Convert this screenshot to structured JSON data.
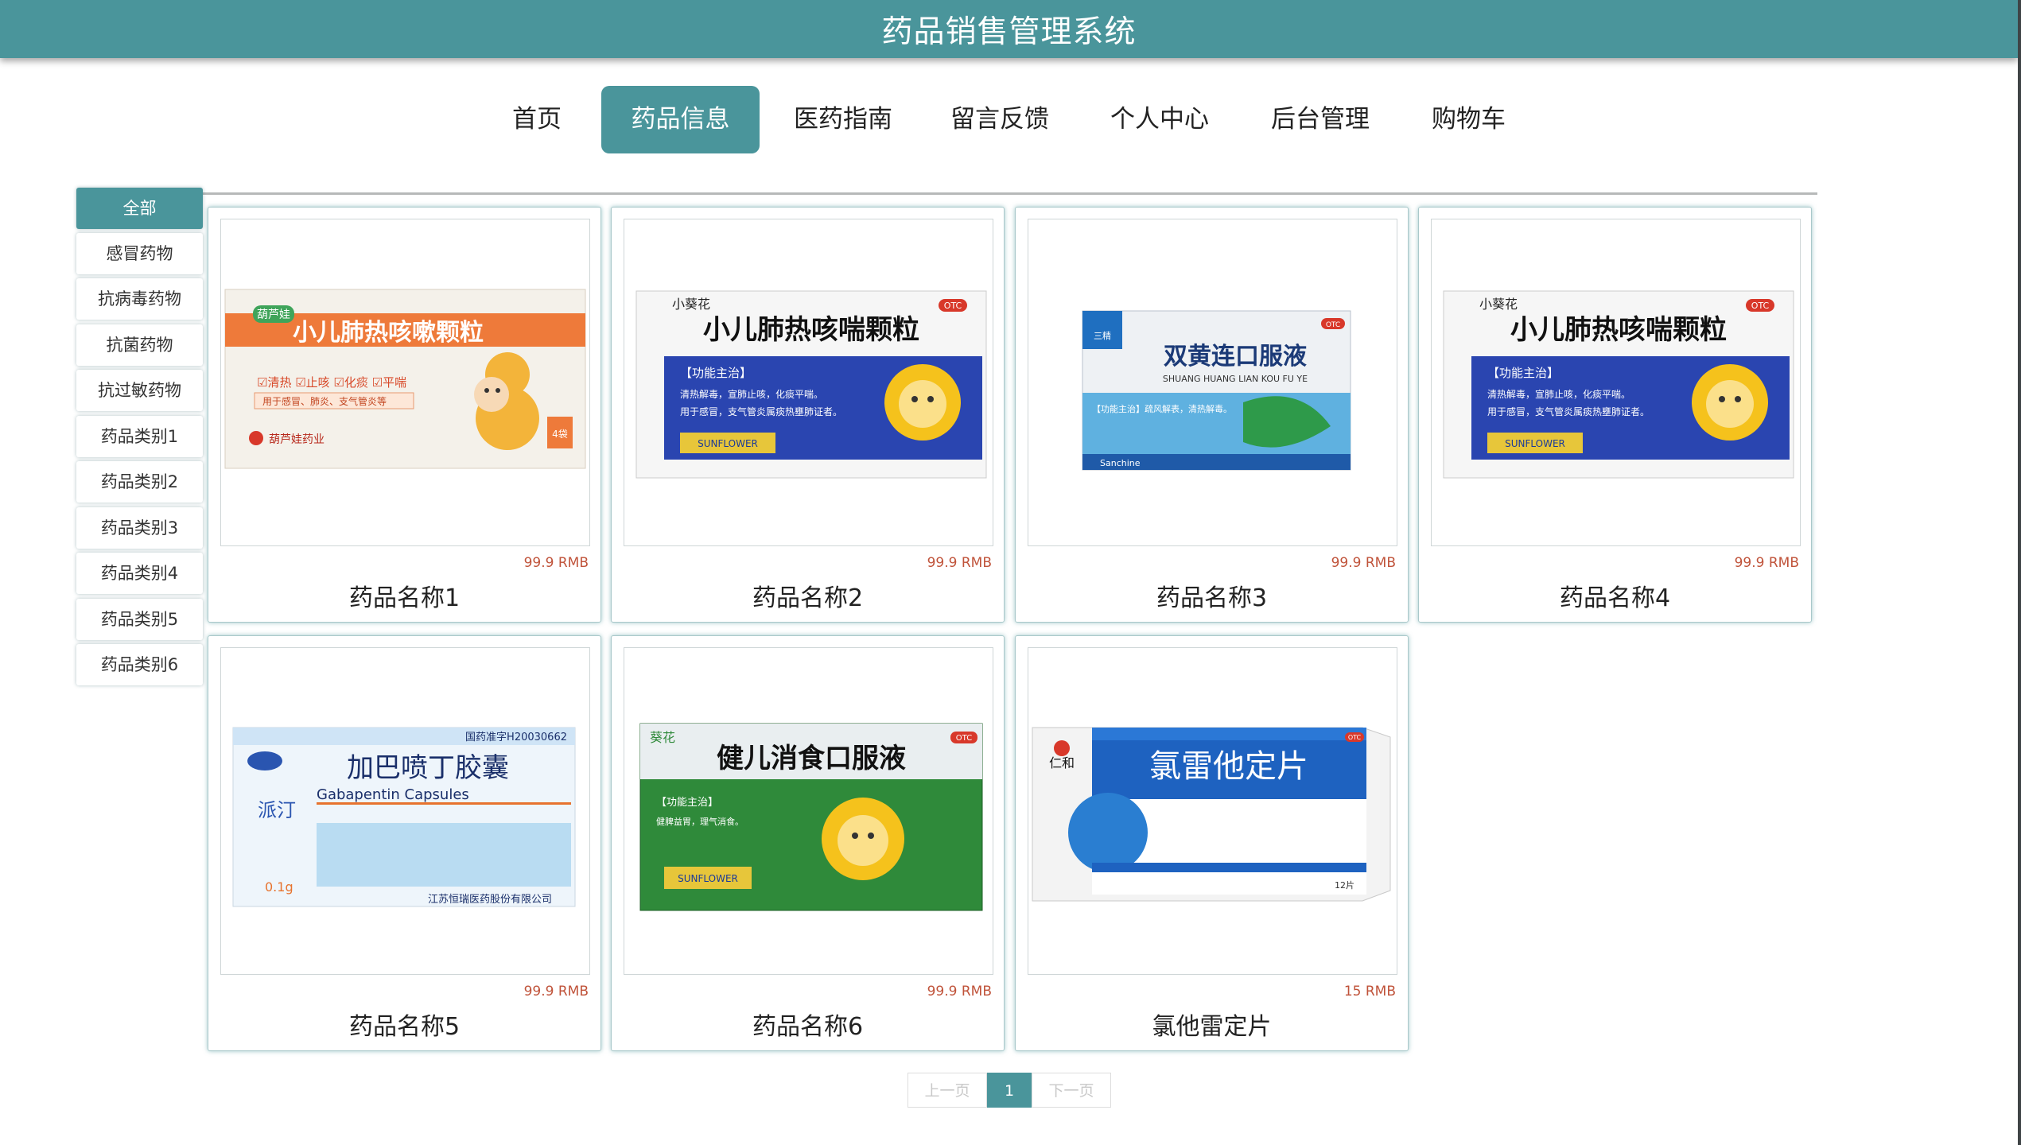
{
  "header": {
    "title": "药品销售管理系统"
  },
  "nav": {
    "items": [
      {
        "label": "首页"
      },
      {
        "label": "药品信息",
        "active": true
      },
      {
        "label": "医药指南"
      },
      {
        "label": "留言反馈"
      },
      {
        "label": "个人中心"
      },
      {
        "label": "后台管理"
      },
      {
        "label": "购物车"
      }
    ]
  },
  "sidebar": {
    "items": [
      {
        "label": "全部",
        "active": true
      },
      {
        "label": "感冒药物"
      },
      {
        "label": "抗病毒药物"
      },
      {
        "label": "抗菌药物"
      },
      {
        "label": "抗过敏药物"
      },
      {
        "label": "药品类别1"
      },
      {
        "label": "药品类别2"
      },
      {
        "label": "药品类别3"
      },
      {
        "label": "药品类别4"
      },
      {
        "label": "药品类别5"
      },
      {
        "label": "药品类别6"
      }
    ]
  },
  "products": [
    {
      "name": "药品名称1",
      "price": "99.9 RMB",
      "box": {
        "brand": "葫芦娃",
        "title": "小儿肺热咳嗽颗粒",
        "tags": "☑清热 ☑止咳 ☑化痰 ☑平喘",
        "usage": "用于感冒、肺炎、支气管炎等",
        "maker": "葫芦娃药业",
        "count": "4袋"
      }
    },
    {
      "name": "药品名称2",
      "price": "99.9 RMB",
      "box": {
        "brand": "小葵花",
        "otc": "OTC",
        "title": "小儿肺热咳喘颗粒",
        "section": "【功能主治】",
        "desc1": "清热解毒，宣肺止咳，化痰平喘。",
        "desc2": "用于感冒，支气管炎属痰热壅肺证者。",
        "logo": "SUNFLOWER"
      }
    },
    {
      "name": "药品名称3",
      "price": "99.9 RMB",
      "box": {
        "brand": "三精",
        "otc": "OTC",
        "title": "双黄连口服液",
        "pinyin": "SHUANG HUANG LIAN KOU FU YE",
        "desc1": "【功能主治】疏风解表，清热解毒。",
        "maker": "Sanchine"
      }
    },
    {
      "name": "药品名称4",
      "price": "99.9 RMB",
      "box": {
        "brand": "小葵花",
        "otc": "OTC",
        "title": "小儿肺热咳喘颗粒",
        "section": "【功能主治】",
        "desc1": "清热解毒，宣肺止咳，化痰平喘。",
        "desc2": "用于感冒，支气管炎属痰热壅肺证者。",
        "logo": "SUNFLOWER"
      }
    },
    {
      "name": "药品名称5",
      "price": "99.9 RMB",
      "box": {
        "approval": "国药准字H20030662",
        "brand": "派汀",
        "title": "加巴喷丁胶囊",
        "english": "Gabapentin Capsules",
        "dose": "0.1g",
        "maker": "江苏恒瑞医药股份有限公司"
      }
    },
    {
      "name": "药品名称6",
      "price": "99.9 RMB",
      "box": {
        "brand": "葵花",
        "otc": "OTC",
        "title": "健儿消食口服液",
        "section": "【功能主治】",
        "desc1": "健脾益胃，理气消食。",
        "logo": "SUNFLOWER"
      }
    },
    {
      "name": "氯他雷定片",
      "price": "15 RMB",
      "box": {
        "brand": "仁和",
        "otc": "OTC",
        "title": "氯雷他定片",
        "count": "12片"
      }
    }
  ],
  "pagination": {
    "prev": "上一页",
    "current": "1",
    "next": "下一页"
  },
  "colors": {
    "primary": "#4a959b",
    "price": "#c0533a"
  }
}
